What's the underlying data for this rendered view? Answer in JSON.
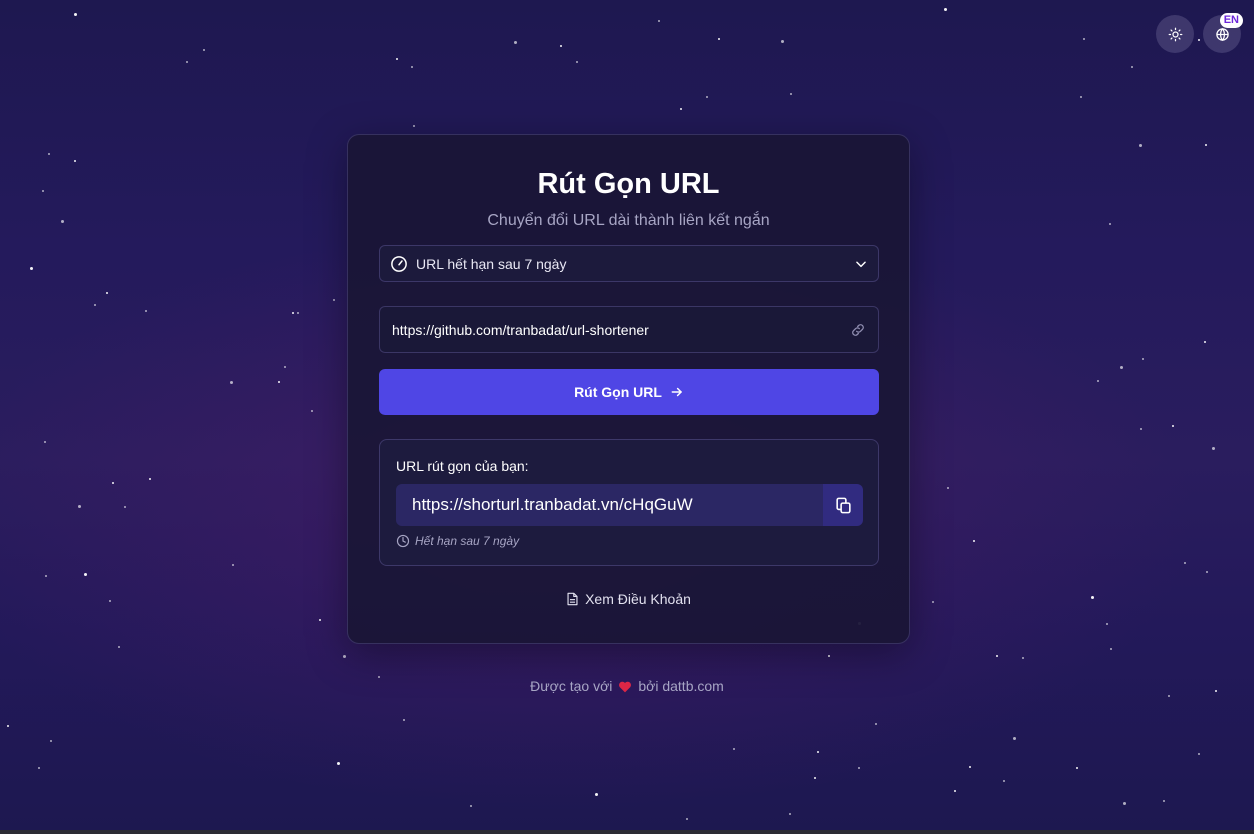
{
  "controls": {
    "theme_toggle_icon": "sun-icon",
    "language_icon": "globe-icon",
    "language_badge": "EN"
  },
  "card": {
    "title": "Rút Gọn URL",
    "subtitle": "Chuyển đổi URL dài thành liên kết ngắn",
    "expiry_select": {
      "selected": "URL hết hạn sau 7 ngày",
      "icon": "gauge-icon"
    },
    "url_input": {
      "value": "https://github.com/tranbadat/url-shortener",
      "icon": "link-icon"
    },
    "submit_label": "Rút Gọn URL",
    "result": {
      "label": "URL rút gọn của bạn:",
      "short_url": "https://shorturl.tranbadat.vn/cHqGuW",
      "expiry_note": "Hết hạn sau 7 ngày"
    },
    "terms_label": "Xem Điều Khoản"
  },
  "footer": {
    "made_with": "Được tạo với",
    "by": "bởi dattb.com"
  },
  "colors": {
    "accent": "#4f46e5",
    "heart": "#dc2646",
    "badge_text": "#6d28d9"
  }
}
